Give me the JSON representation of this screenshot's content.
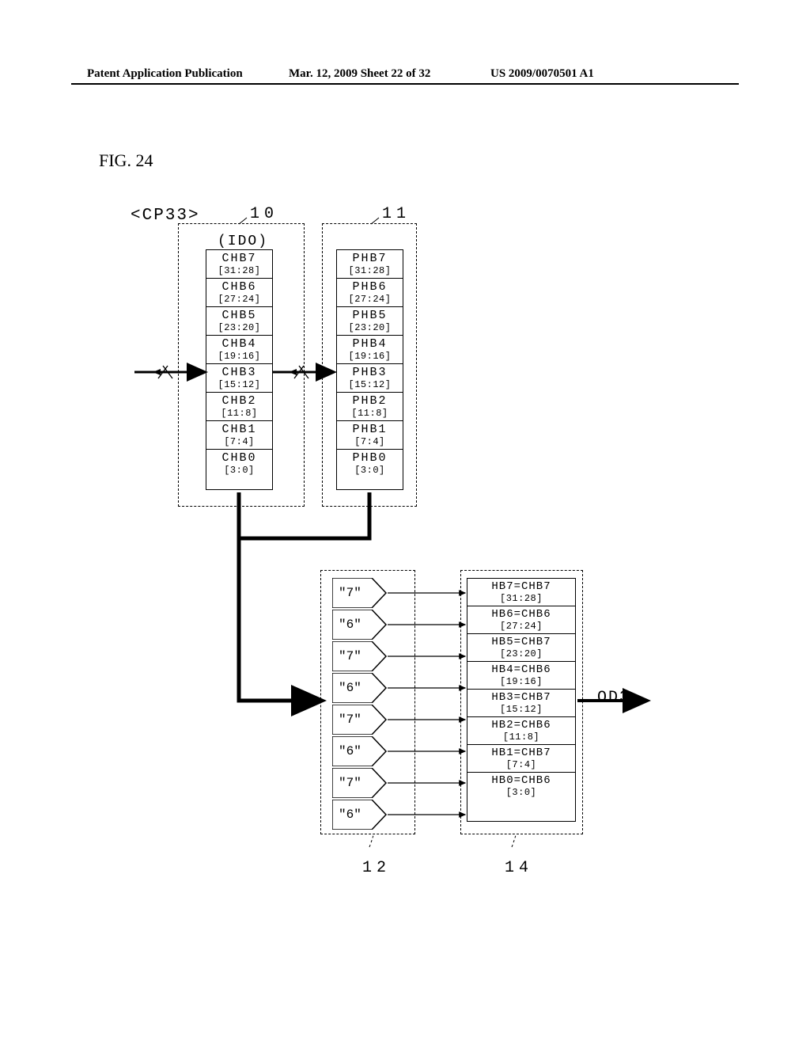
{
  "header": {
    "left": "Patent Application Publication",
    "mid": "Mar. 12, 2009  Sheet 22 of 32",
    "right": "US 2009/0070501 A1"
  },
  "figure_label": "FIG. 24",
  "cp_label": "<CP33>",
  "refs": {
    "r10": "10",
    "r11": "11",
    "r12": "12",
    "r14": "14"
  },
  "ido": "(IDO)",
  "od3": "OD3",
  "reg10": [
    {
      "n": "CHB7",
      "b": "[31:28]"
    },
    {
      "n": "CHB6",
      "b": "[27:24]"
    },
    {
      "n": "CHB5",
      "b": "[23:20]"
    },
    {
      "n": "CHB4",
      "b": "[19:16]"
    },
    {
      "n": "CHB3",
      "b": "[15:12]"
    },
    {
      "n": "CHB2",
      "b": "[11:8]"
    },
    {
      "n": "CHB1",
      "b": "[7:4]"
    },
    {
      "n": "CHB0",
      "b": "[3:0]"
    }
  ],
  "reg11": [
    {
      "n": "PHB7",
      "b": "[31:28]"
    },
    {
      "n": "PHB6",
      "b": "[27:24]"
    },
    {
      "n": "PHB5",
      "b": "[23:20]"
    },
    {
      "n": "PHB4",
      "b": "[19:16]"
    },
    {
      "n": "PHB3",
      "b": "[15:12]"
    },
    {
      "n": "PHB2",
      "b": "[11:8]"
    },
    {
      "n": "PHB1",
      "b": "[7:4]"
    },
    {
      "n": "PHB0",
      "b": "[3:0]"
    }
  ],
  "mux_sel": [
    "\"7\"",
    "\"6\"",
    "\"7\"",
    "\"6\"",
    "\"7\"",
    "\"6\"",
    "\"7\"",
    "\"6\""
  ],
  "reg14": [
    {
      "n": "HB7=CHB7",
      "b": "[31:28]"
    },
    {
      "n": "HB6=CHB6",
      "b": "[27:24]"
    },
    {
      "n": "HB5=CHB7",
      "b": "[23:20]"
    },
    {
      "n": "HB4=CHB6",
      "b": "[19:16]"
    },
    {
      "n": "HB3=CHB7",
      "b": "[15:12]"
    },
    {
      "n": "HB2=CHB6",
      "b": "[11:8]"
    },
    {
      "n": "HB1=CHB7",
      "b": "[7:4]"
    },
    {
      "n": "HB0=CHB6",
      "b": "[3:0]"
    }
  ]
}
